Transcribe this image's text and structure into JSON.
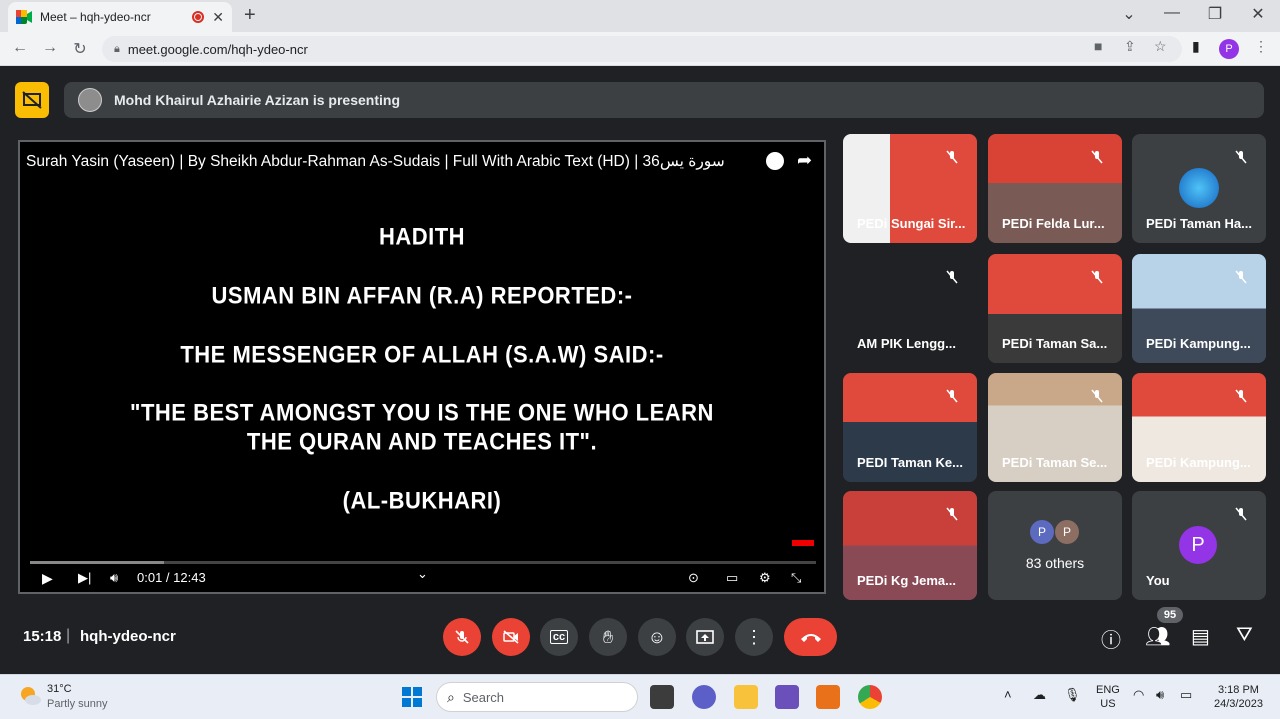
{
  "browser": {
    "tab_title": "Meet – hqh-ydeo-ncr",
    "url": "meet.google.com/hqh-ydeo-ncr",
    "profile_initial": "P"
  },
  "presenting": {
    "text": "Mohd Khairul Azhairie Azizan is presenting"
  },
  "video": {
    "title": "Surah Yasin (Yaseen) | By Sheikh Abdur-Rahman As-Sudais | Full With Arabic Text (HD) | 36سورة يس",
    "lines": [
      "HADITH",
      "USMAN BIN AFFAN (R.A) REPORTED:-",
      "THE MESSENGER OF ALLAH (S.A.W) SAID:-",
      "\"THE BEST AMONGST YOU IS THE ONE WHO LEARN",
      "THE QURAN AND TEACHES IT\".",
      "(AL-BUKHARI)"
    ],
    "time": "0:01 / 12:43",
    "progress_fraction": 0.17
  },
  "participants": [
    {
      "name": "PEDi Sungai Sir..."
    },
    {
      "name": "PEDi Felda Lur..."
    },
    {
      "name": "PEDi Taman Ha..."
    },
    {
      "name": "AM PIK Lengg..."
    },
    {
      "name": "PEDi Taman Sa..."
    },
    {
      "name": "PEDi Kampung..."
    },
    {
      "name": "PEDI Taman Ke..."
    },
    {
      "name": "PEDi Taman Se..."
    },
    {
      "name": "PEDi Kampung..."
    },
    {
      "name": "PEDi Kg Jema..."
    },
    {
      "name": "83 others",
      "avatars": [
        "P",
        "P"
      ]
    },
    {
      "name": "You",
      "avatar": "P"
    }
  ],
  "bottom": {
    "time": "15:18",
    "separator": "|",
    "meeting_code": "hqh-ydeo-ncr",
    "participant_count": "95"
  },
  "taskbar": {
    "temperature": "31°C",
    "condition": "Partly sunny",
    "search_label": "Search",
    "lang_top": "ENG",
    "lang_bottom": "US",
    "time": "3:18 PM",
    "date": "24/3/2023"
  }
}
